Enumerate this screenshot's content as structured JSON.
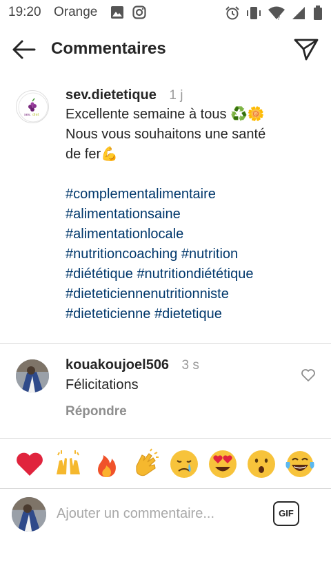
{
  "status_bar": {
    "time": "19:20",
    "carrier": "Orange",
    "left_icons": [
      "gallery-icon",
      "instagram-icon"
    ],
    "right_icons": [
      "alarm-icon",
      "vibrate-icon",
      "wifi-icon",
      "signal-icon",
      "battery-icon"
    ]
  },
  "header": {
    "title": "Commentaires",
    "back_icon": "arrow-left-icon",
    "send_icon": "paper-plane-icon"
  },
  "caption": {
    "username": "sev.dietetique",
    "time": "1 j",
    "text_lines": [
      "Excellente semaine à tous ♻️🌼",
      "Nous vous souhaitons une santé",
      "de fer💪"
    ],
    "hashtag_lines": [
      [
        "#complementalimentaire"
      ],
      [
        "#alimentationsaine"
      ],
      [
        "#alimentationlocale"
      ],
      [
        "#nutritioncoaching",
        "#nutrition"
      ],
      [
        "#diététique",
        "#nutritiondiététique"
      ],
      [
        "#dieteticiennenutritionniste"
      ],
      [
        "#dieteticienne",
        "#dietetique"
      ]
    ]
  },
  "comment": {
    "username": "kouakoujoel506",
    "time": "3 s",
    "text": "Félicitations",
    "reply_label": "Répondre"
  },
  "emoji_bar": [
    "heart",
    "raising-hands",
    "fire",
    "clapping-hands",
    "crying-face",
    "heart-eyes",
    "surprised-face",
    "tears-of-joy"
  ],
  "composer": {
    "placeholder": "Ajouter un commentaire...",
    "gif_label": "GIF"
  },
  "colors": {
    "hashtag": "#00376b",
    "secondary_text": "#8e8e8e",
    "divider": "#dbdbdb",
    "heart": "#e0243d"
  }
}
